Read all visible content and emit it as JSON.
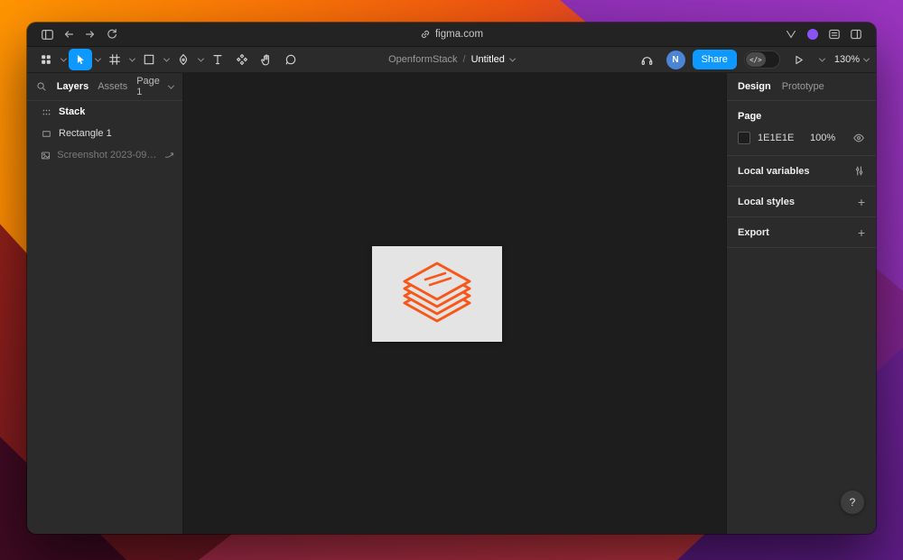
{
  "browser": {
    "url": "figma.com"
  },
  "toolbar": {
    "breadcrumb_team": "OpenformStack",
    "breadcrumb_sep": "/",
    "breadcrumb_file": "Untitled",
    "share_label": "Share",
    "devmode_glyph": "</>",
    "zoom_level": "130%",
    "avatar_initial": "N"
  },
  "left_panel": {
    "tab_layers": "Layers",
    "tab_assets": "Assets",
    "page_selector": "Page 1",
    "layers": [
      {
        "name": "Stack"
      },
      {
        "name": "Rectangle 1"
      },
      {
        "name": "Screenshot 2023-09-15 ..."
      }
    ]
  },
  "right_panel": {
    "tab_design": "Design",
    "tab_prototype": "Prototype",
    "page": {
      "label": "Page",
      "color_hex": "1E1E1E",
      "opacity": "100%"
    },
    "sections": {
      "variables": "Local variables",
      "styles": "Local styles",
      "export": "Export"
    },
    "plus": "+",
    "help": "?"
  },
  "colors": {
    "accent_blue": "#0d99ff",
    "chrome_bg": "#232323",
    "toolbar_bg": "#2b2b2b",
    "panel_bg": "#2b2b2b",
    "canvas_bg": "#1d1d1d",
    "artboard_bg": "#e4e4e4",
    "logo_orange": "#f9571a",
    "avatar_blue": "#4a85d6",
    "page_swatch": "#1E1E1E",
    "profile_purple": "#8a53f5",
    "help_bg": "#3d3d3d"
  }
}
